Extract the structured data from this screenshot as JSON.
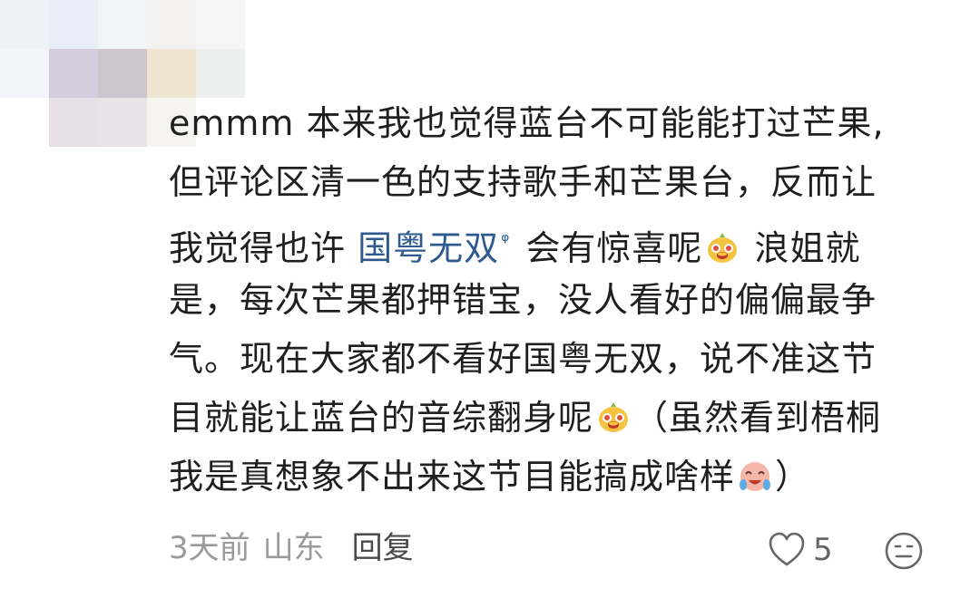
{
  "comment": {
    "lines": [
      [
        "emmm 本来我也觉得蓝台不可能能打过芒果,"
      ],
      [
        "但评论区清一色的支持歌手和芒果台，反而让"
      ],
      [
        "我觉得也许 ",
        "国粤无双",
        " 会有惊喜呢",
        " 浪姐就"
      ],
      [
        "是，每次芒果都押错宝，没人看好的偏偏最争"
      ],
      [
        "气。现在大家都不看好国粤无双，说不准这节"
      ],
      [
        "目就能让蓝台的音综翻身呢",
        "（虽然看到梧桐"
      ],
      [
        "我是真想象不出来这节目能搞成啥样",
        "）"
      ]
    ],
    "topic_mark": "ᵠ",
    "emoji_1": "doge-mango-emoji",
    "emoji_2": "doge-mango-emoji",
    "emoji_3": "crying-laugh-emoji"
  },
  "meta": {
    "time": "3天前",
    "location": "山东",
    "reply_label": "回复"
  },
  "like": {
    "icon": "heart-icon",
    "count": "5"
  },
  "face_button": {
    "icon": "emoji-face-icon"
  },
  "colors": {
    "topic": "#2f5a8f",
    "meta": "#9a9a9a"
  }
}
